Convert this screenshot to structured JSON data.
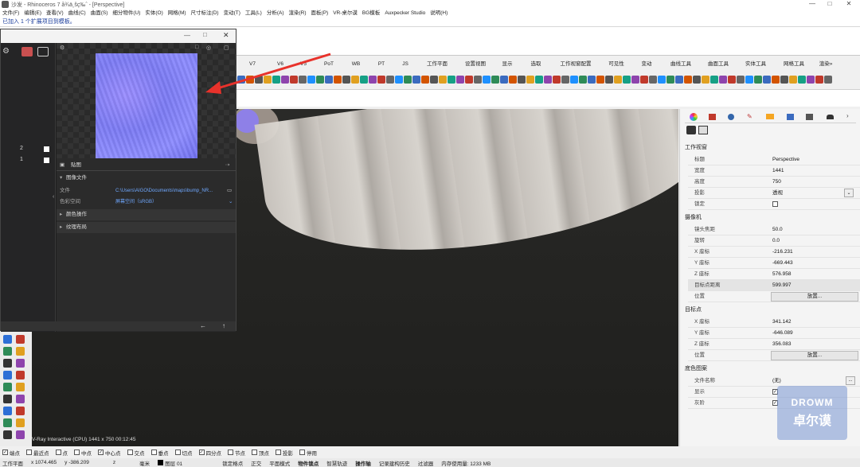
{
  "titlebar": {
    "title": "沙发 - Rhinoceros 7 å¾ä¸šç‰ˆ - [Perspective]",
    "minimize": "—",
    "maximize": "□",
    "close": "✕"
  },
  "menubar": [
    "文件(F)",
    "编辑(E)",
    "查看(V)",
    "曲线(C)",
    "曲面(S)",
    "细分物件(U)",
    "实体(O)",
    "网格(M)",
    "尺寸标注(D)",
    "变动(T)",
    "工具(L)",
    "分析(A)",
    "渲染(R)",
    "面板(P)",
    "VR-桌尔谟",
    "BG模板",
    "Auxpecker Studio",
    "说明(H)"
  ],
  "command": {
    "history": "已加入 1 个扩展项目到模板。"
  },
  "tabs": [
    "V7",
    "V6",
    "V5",
    "PoT",
    "WB",
    "PT",
    "JS",
    "工作平面",
    "设置视图",
    "显示",
    "选取",
    "工作视窗配置",
    "可见性",
    "变动",
    "曲线工具",
    "曲面工具",
    "实体工具",
    "网格工具",
    "渲染»"
  ],
  "float_panel": {
    "sidebar_values": [
      "2",
      "1"
    ],
    "map_section": "贴图",
    "image_file_header": "图像文件",
    "file_label": "文件",
    "file_path": "C:\\Users\\AIGO\\Documents\\maps\\bump_NR...",
    "color_space_label": "色彩空间",
    "color_space_value": "屏幕空间（sRGB）",
    "color_ops": "颜色操作",
    "texture_layout": "纹理布局"
  },
  "viewport": {
    "status": "V-Ray Interactive (CPU)   1441 x 750   00:12:45"
  },
  "right_panel": {
    "viewport_section": "工作视窗",
    "viewport_rows": [
      {
        "k": "标题",
        "v": "Perspective"
      },
      {
        "k": "宽度",
        "v": "1441"
      },
      {
        "k": "高度",
        "v": "750"
      },
      {
        "k": "投影",
        "v": "透视"
      },
      {
        "k": "锁定",
        "v": ""
      }
    ],
    "camera_section": "摄像机",
    "camera_rows": [
      {
        "k": "镜头焦距",
        "v": "50.0"
      },
      {
        "k": "旋转",
        "v": "0.0"
      },
      {
        "k": "X 座标",
        "v": "-216.231"
      },
      {
        "k": "Y 座标",
        "v": "-669.443"
      },
      {
        "k": "Z 座标",
        "v": "576.958"
      },
      {
        "k": "目标点距离",
        "v": "599.997"
      },
      {
        "k": "位置",
        "v": "放置..."
      }
    ],
    "target_section": "目标点",
    "target_rows": [
      {
        "k": "X 座标",
        "v": "341.142"
      },
      {
        "k": "Y 座标",
        "v": "-646.089"
      },
      {
        "k": "Z 座标",
        "v": "356.083"
      },
      {
        "k": "位置",
        "v": "放置..."
      }
    ],
    "wallpaper_section": "底色图案",
    "wallpaper_rows": [
      {
        "k": "文件名称",
        "v": "(无)"
      },
      {
        "k": "显示",
        "v": "✓"
      },
      {
        "k": "灰阶",
        "v": "✓"
      }
    ]
  },
  "osnap": [
    "端点",
    "最近点",
    "点",
    "中点",
    "中心点",
    "交点",
    "垂点",
    "切点",
    "四分点",
    "节点",
    "顶点",
    "投影",
    "停用"
  ],
  "statusbar": {
    "plane": "工作平面",
    "x": "x 1074.465",
    "y": "y -386.209",
    "z": "z",
    "unit": "毫米",
    "layer": "图层 01",
    "items": [
      "锁定格点",
      "正交",
      "平面模式",
      "物件锁点",
      "智慧轨迹",
      "操作轴",
      "记录建构历史",
      "过滤器",
      "内存使用量: 1233 MB"
    ]
  },
  "watermark": {
    "line1": "DROWM",
    "line2": "卓尔谟"
  }
}
